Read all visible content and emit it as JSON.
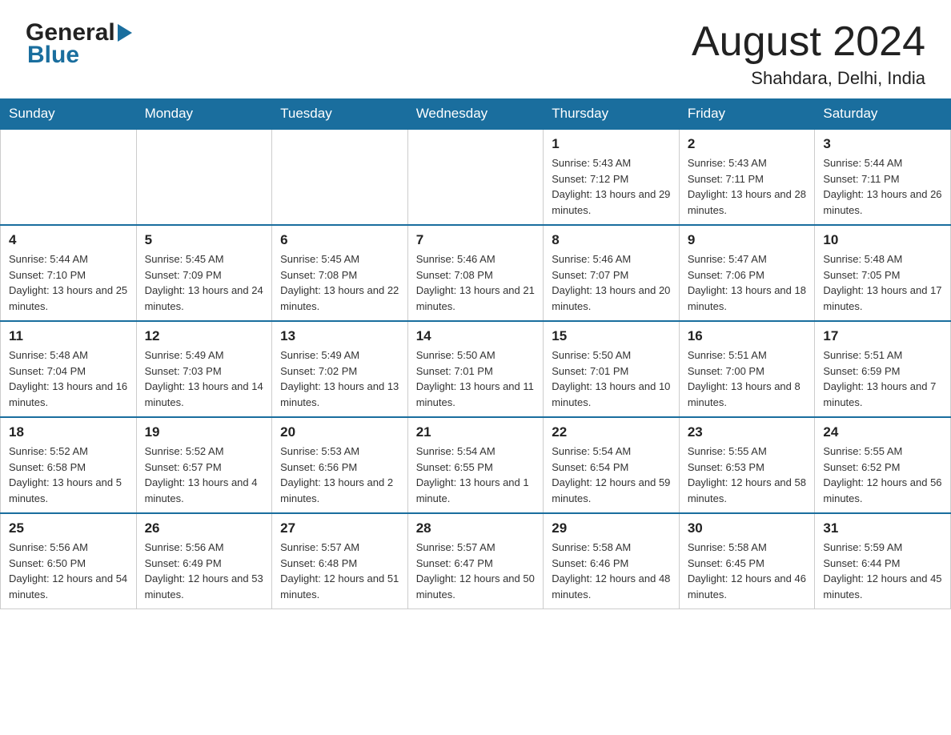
{
  "header": {
    "month_title": "August 2024",
    "location": "Shahdara, Delhi, India",
    "logo_general": "General",
    "logo_blue": "Blue"
  },
  "days_of_week": [
    "Sunday",
    "Monday",
    "Tuesday",
    "Wednesday",
    "Thursday",
    "Friday",
    "Saturday"
  ],
  "weeks": [
    {
      "days": [
        {
          "number": "",
          "info": ""
        },
        {
          "number": "",
          "info": ""
        },
        {
          "number": "",
          "info": ""
        },
        {
          "number": "",
          "info": ""
        },
        {
          "number": "1",
          "info": "Sunrise: 5:43 AM\nSunset: 7:12 PM\nDaylight: 13 hours and 29 minutes."
        },
        {
          "number": "2",
          "info": "Sunrise: 5:43 AM\nSunset: 7:11 PM\nDaylight: 13 hours and 28 minutes."
        },
        {
          "number": "3",
          "info": "Sunrise: 5:44 AM\nSunset: 7:11 PM\nDaylight: 13 hours and 26 minutes."
        }
      ]
    },
    {
      "days": [
        {
          "number": "4",
          "info": "Sunrise: 5:44 AM\nSunset: 7:10 PM\nDaylight: 13 hours and 25 minutes."
        },
        {
          "number": "5",
          "info": "Sunrise: 5:45 AM\nSunset: 7:09 PM\nDaylight: 13 hours and 24 minutes."
        },
        {
          "number": "6",
          "info": "Sunrise: 5:45 AM\nSunset: 7:08 PM\nDaylight: 13 hours and 22 minutes."
        },
        {
          "number": "7",
          "info": "Sunrise: 5:46 AM\nSunset: 7:08 PM\nDaylight: 13 hours and 21 minutes."
        },
        {
          "number": "8",
          "info": "Sunrise: 5:46 AM\nSunset: 7:07 PM\nDaylight: 13 hours and 20 minutes."
        },
        {
          "number": "9",
          "info": "Sunrise: 5:47 AM\nSunset: 7:06 PM\nDaylight: 13 hours and 18 minutes."
        },
        {
          "number": "10",
          "info": "Sunrise: 5:48 AM\nSunset: 7:05 PM\nDaylight: 13 hours and 17 minutes."
        }
      ]
    },
    {
      "days": [
        {
          "number": "11",
          "info": "Sunrise: 5:48 AM\nSunset: 7:04 PM\nDaylight: 13 hours and 16 minutes."
        },
        {
          "number": "12",
          "info": "Sunrise: 5:49 AM\nSunset: 7:03 PM\nDaylight: 13 hours and 14 minutes."
        },
        {
          "number": "13",
          "info": "Sunrise: 5:49 AM\nSunset: 7:02 PM\nDaylight: 13 hours and 13 minutes."
        },
        {
          "number": "14",
          "info": "Sunrise: 5:50 AM\nSunset: 7:01 PM\nDaylight: 13 hours and 11 minutes."
        },
        {
          "number": "15",
          "info": "Sunrise: 5:50 AM\nSunset: 7:01 PM\nDaylight: 13 hours and 10 minutes."
        },
        {
          "number": "16",
          "info": "Sunrise: 5:51 AM\nSunset: 7:00 PM\nDaylight: 13 hours and 8 minutes."
        },
        {
          "number": "17",
          "info": "Sunrise: 5:51 AM\nSunset: 6:59 PM\nDaylight: 13 hours and 7 minutes."
        }
      ]
    },
    {
      "days": [
        {
          "number": "18",
          "info": "Sunrise: 5:52 AM\nSunset: 6:58 PM\nDaylight: 13 hours and 5 minutes."
        },
        {
          "number": "19",
          "info": "Sunrise: 5:52 AM\nSunset: 6:57 PM\nDaylight: 13 hours and 4 minutes."
        },
        {
          "number": "20",
          "info": "Sunrise: 5:53 AM\nSunset: 6:56 PM\nDaylight: 13 hours and 2 minutes."
        },
        {
          "number": "21",
          "info": "Sunrise: 5:54 AM\nSunset: 6:55 PM\nDaylight: 13 hours and 1 minute."
        },
        {
          "number": "22",
          "info": "Sunrise: 5:54 AM\nSunset: 6:54 PM\nDaylight: 12 hours and 59 minutes."
        },
        {
          "number": "23",
          "info": "Sunrise: 5:55 AM\nSunset: 6:53 PM\nDaylight: 12 hours and 58 minutes."
        },
        {
          "number": "24",
          "info": "Sunrise: 5:55 AM\nSunset: 6:52 PM\nDaylight: 12 hours and 56 minutes."
        }
      ]
    },
    {
      "days": [
        {
          "number": "25",
          "info": "Sunrise: 5:56 AM\nSunset: 6:50 PM\nDaylight: 12 hours and 54 minutes."
        },
        {
          "number": "26",
          "info": "Sunrise: 5:56 AM\nSunset: 6:49 PM\nDaylight: 12 hours and 53 minutes."
        },
        {
          "number": "27",
          "info": "Sunrise: 5:57 AM\nSunset: 6:48 PM\nDaylight: 12 hours and 51 minutes."
        },
        {
          "number": "28",
          "info": "Sunrise: 5:57 AM\nSunset: 6:47 PM\nDaylight: 12 hours and 50 minutes."
        },
        {
          "number": "29",
          "info": "Sunrise: 5:58 AM\nSunset: 6:46 PM\nDaylight: 12 hours and 48 minutes."
        },
        {
          "number": "30",
          "info": "Sunrise: 5:58 AM\nSunset: 6:45 PM\nDaylight: 12 hours and 46 minutes."
        },
        {
          "number": "31",
          "info": "Sunrise: 5:59 AM\nSunset: 6:44 PM\nDaylight: 12 hours and 45 minutes."
        }
      ]
    }
  ]
}
